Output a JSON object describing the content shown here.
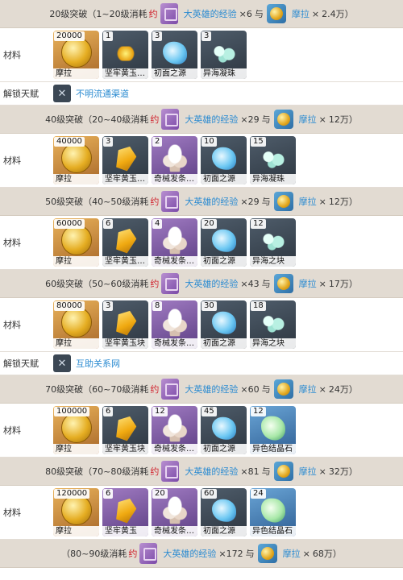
{
  "common": {
    "material_label": "材料",
    "talent_label": "解锁天赋",
    "consume_word": "约",
    "exp_item": "大英雄的经验",
    "times": "×",
    "and_word": "与",
    "mora_item": "摩拉"
  },
  "stages": [
    {
      "title": "20级突破（1~20级消耗",
      "exp_count": "6",
      "mora_amount": "2.4万）",
      "items": [
        {
          "count": "20000",
          "name": "摩拉",
          "icon": "mora-coin-icon",
          "bg": "gold",
          "pic": "coin"
        },
        {
          "count": "1",
          "name": "坚牢黄玉…",
          "icon": "topaz-sliver-icon",
          "bg": "dark",
          "pic": "gemsm"
        },
        {
          "count": "3",
          "name": "初面之源",
          "icon": "crystal-icon",
          "bg": "dark",
          "pic": "crys"
        },
        {
          "count": "3",
          "name": "异海凝珠",
          "icon": "pearl-icon",
          "bg": "dark",
          "pic": "pearl"
        }
      ],
      "talent": {
        "name": "不明流通渠道",
        "icon": "pipe-talent-icon"
      }
    },
    {
      "title": "40级突破（20~40级消耗",
      "exp_count": "29",
      "mora_amount": "12万）",
      "items": [
        {
          "count": "40000",
          "name": "摩拉",
          "icon": "mora-coin-icon",
          "bg": "gold",
          "pic": "coin"
        },
        {
          "count": "3",
          "name": "坚牢黄玉…",
          "icon": "topaz-fragment-icon",
          "bg": "dark",
          "pic": "gem"
        },
        {
          "count": "2",
          "name": "奇械发条…",
          "icon": "clockwork-icon",
          "bg": "purple",
          "pic": "coral"
        },
        {
          "count": "10",
          "name": "初面之源",
          "icon": "crystal-icon",
          "bg": "dark",
          "pic": "crys"
        },
        {
          "count": "15",
          "name": "异海凝珠",
          "icon": "pearl-icon",
          "bg": "dark",
          "pic": "pearl"
        }
      ]
    },
    {
      "title": "50级突破（40~50级消耗",
      "exp_count": "29",
      "mora_amount": "12万）",
      "items": [
        {
          "count": "60000",
          "name": "摩拉",
          "icon": "mora-coin-icon",
          "bg": "gold",
          "pic": "coin"
        },
        {
          "count": "6",
          "name": "坚牢黄玉…",
          "icon": "topaz-fragment-icon",
          "bg": "dark",
          "pic": "gem"
        },
        {
          "count": "4",
          "name": "奇械发条…",
          "icon": "clockwork-icon",
          "bg": "purple",
          "pic": "coral"
        },
        {
          "count": "20",
          "name": "初面之源",
          "icon": "crystal-icon",
          "bg": "dark",
          "pic": "crys"
        },
        {
          "count": "12",
          "name": "异海之块",
          "icon": "pearl-icon",
          "bg": "dark",
          "pic": "pearl"
        }
      ]
    },
    {
      "title": "60级突破（50~60级消耗",
      "exp_count": "43",
      "mora_amount": "17万）",
      "items": [
        {
          "count": "80000",
          "name": "摩拉",
          "icon": "mora-coin-icon",
          "bg": "gold",
          "pic": "coin"
        },
        {
          "count": "3",
          "name": "坚牢黄玉块",
          "icon": "topaz-chunk-icon",
          "bg": "dark",
          "pic": "gem"
        },
        {
          "count": "8",
          "name": "奇械发条…",
          "icon": "clockwork-icon",
          "bg": "purple",
          "pic": "coral"
        },
        {
          "count": "30",
          "name": "初面之源",
          "icon": "crystal-icon",
          "bg": "dark",
          "pic": "crys"
        },
        {
          "count": "18",
          "name": "异海之块",
          "icon": "pearl-icon",
          "bg": "dark",
          "pic": "pearl"
        }
      ],
      "talent": {
        "name": "互助关系网",
        "icon": "network-talent-icon"
      }
    },
    {
      "title": "70级突破（60~70级消耗",
      "exp_count": "60",
      "mora_amount": "24万）",
      "items": [
        {
          "count": "100000",
          "name": "摩拉",
          "icon": "mora-coin-icon",
          "bg": "gold",
          "pic": "coin"
        },
        {
          "count": "6",
          "name": "坚牢黄玉块",
          "icon": "topaz-chunk-icon",
          "bg": "dark",
          "pic": "gem"
        },
        {
          "count": "12",
          "name": "奇械发条…",
          "icon": "clockwork-icon",
          "bg": "purple",
          "pic": "coral"
        },
        {
          "count": "45",
          "name": "初面之源",
          "icon": "crystal-icon",
          "bg": "dark",
          "pic": "crys"
        },
        {
          "count": "12",
          "name": "异色结晶石",
          "icon": "crystal-stone-icon",
          "bg": "blue",
          "pic": "green"
        }
      ]
    },
    {
      "title": "80级突破（70~80级消耗",
      "exp_count": "81",
      "mora_amount": "32万）",
      "items": [
        {
          "count": "120000",
          "name": "摩拉",
          "icon": "mora-coin-icon",
          "bg": "gold",
          "pic": "coin"
        },
        {
          "count": "6",
          "name": "坚牢黄玉",
          "icon": "topaz-gemstone-icon",
          "bg": "purple",
          "pic": "gem"
        },
        {
          "count": "20",
          "name": "奇械发条…",
          "icon": "clockwork-icon",
          "bg": "purple",
          "pic": "coral"
        },
        {
          "count": "60",
          "name": "初面之源",
          "icon": "crystal-icon",
          "bg": "dark",
          "pic": "crys"
        },
        {
          "count": "24",
          "name": "异色结晶石",
          "icon": "crystal-stone-icon",
          "bg": "blue",
          "pic": "green"
        }
      ]
    }
  ],
  "final": {
    "title": "（80~90级消耗",
    "exp_count": "172",
    "mora_amount": "68万）"
  }
}
